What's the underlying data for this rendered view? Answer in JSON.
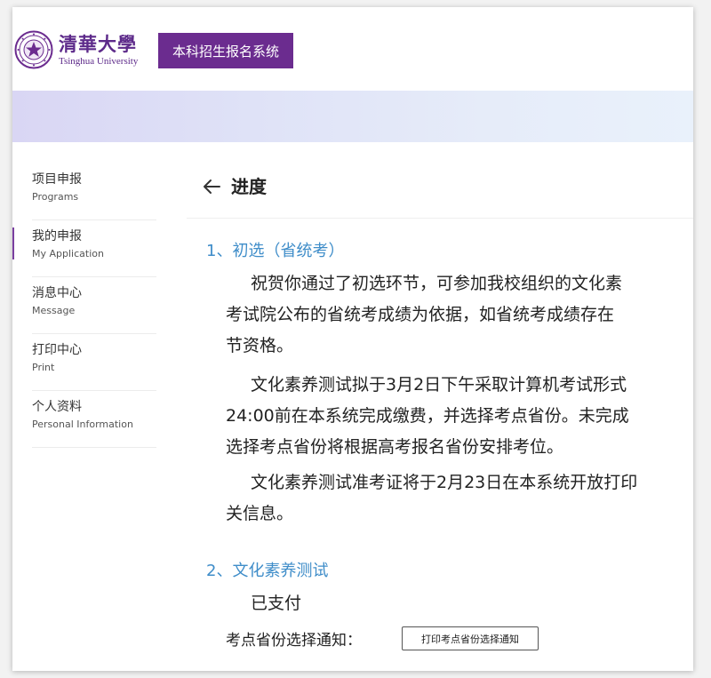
{
  "header": {
    "university_cn": "清華大學",
    "university_en": "Tsinghua University",
    "system_title": "本科招生报名系统"
  },
  "sidebar": {
    "items": [
      {
        "cn": "项目申报",
        "en": "Programs"
      },
      {
        "cn": "我的申报",
        "en": "My Application"
      },
      {
        "cn": "消息中心",
        "en": "Message"
      },
      {
        "cn": "打印中心",
        "en": "Print"
      },
      {
        "cn": "个人资料",
        "en": "Personal Information"
      }
    ]
  },
  "main": {
    "title": "进度",
    "section1": {
      "title": "1、初选（省统考）",
      "para1": [
        "祝贺你通过了初选环节，可参加我校组织的文化素",
        "考试院公布的省统考成绩为依据，如省统考成绩存在",
        "节资格。"
      ],
      "para2": [
        "文化素养测试拟于3月2日下午采取计算机考试形式",
        "24:00前在本系统完成缴费，并选择考点省份。未完成",
        "选择考点省份将根据高考报名省份安排考位。"
      ],
      "para3": [
        "文化素养测试准考证将于2月23日在本系统开放打印",
        "关信息。"
      ]
    },
    "section2": {
      "title": "2、文化素养测试",
      "status": "已支付",
      "notice_label": "考点省份选择通知：",
      "print_button": "打印考点省份选择通知"
    }
  },
  "colors": {
    "brand_purple": "#6b2c8f",
    "section_blue": "#3f8dc9"
  }
}
